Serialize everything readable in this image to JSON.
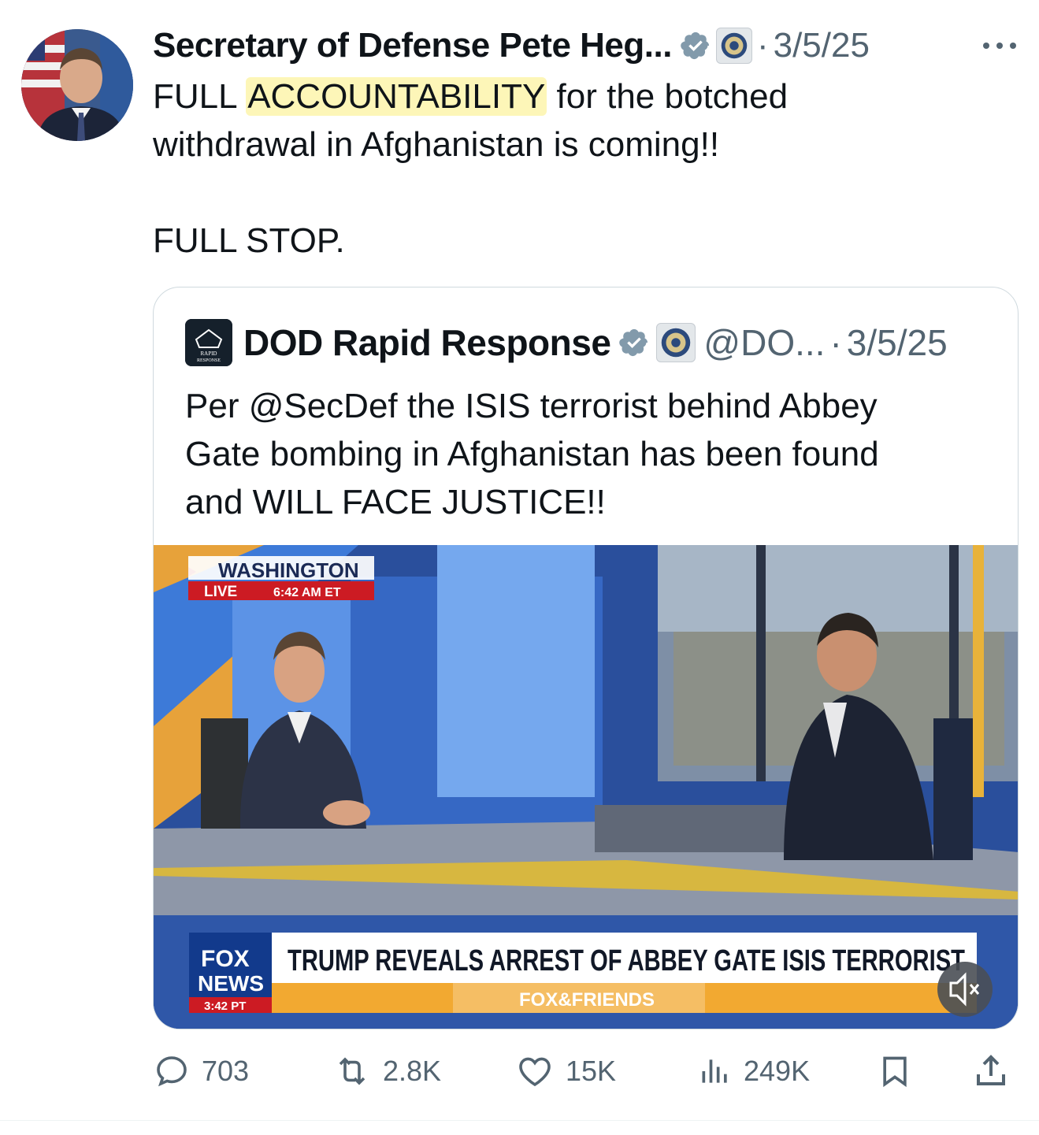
{
  "post": {
    "author_name": "Secretary of Defense Pete Heg...",
    "separator": "·",
    "date": "3/5/25",
    "text": {
      "before_highlight": "FULL ",
      "highlight": "ACCOUNTABILITY",
      "after_highlight": " for the botched",
      "line2": "withdrawal in Afghanistan is coming!!",
      "line3": "FULL STOP."
    },
    "highlight_color": "#fdf6b8"
  },
  "quote": {
    "author_name": "DOD Rapid Response",
    "handle": "@DO...",
    "separator": "·",
    "date": "3/5/25",
    "avatar_text": [
      "RAPID",
      "RESPONSE"
    ],
    "text_lines": [
      "Per @SecDef the ISIS terrorist behind Abbey",
      "Gate bombing in Afghanistan has been found",
      "and WILL FACE JUSTICE!!"
    ],
    "video": {
      "location": "WASHINGTON",
      "live": "LIVE",
      "live_time": "6:42 AM ET",
      "network_line1": "FOX",
      "network_line2": "NEWS",
      "network_time": "3:42 PT",
      "headline": "TRUMP REVEALS ARREST OF ABBEY GATE ISIS TERRORIST",
      "show": "FOX&FRIENDS",
      "muted": true
    }
  },
  "actions": {
    "replies": "703",
    "reposts": "2.8K",
    "likes": "15K",
    "views": "249K"
  },
  "colors": {
    "verified": "#829aab",
    "text_primary": "#0f1419",
    "text_secondary": "#536471",
    "border": "#cfd9de"
  },
  "icons": [
    "verified-icon",
    "affiliate-badge-icon",
    "more-icon",
    "mute-icon",
    "reply-icon",
    "repost-icon",
    "like-icon",
    "views-icon",
    "bookmark-icon",
    "share-icon"
  ]
}
